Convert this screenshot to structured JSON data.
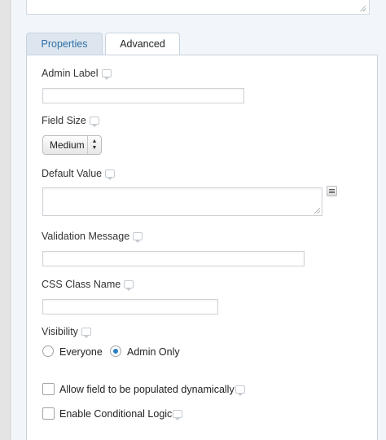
{
  "tabs": [
    {
      "label": "Properties",
      "active": false
    },
    {
      "label": "Advanced",
      "active": true
    }
  ],
  "fields": {
    "admin_label": {
      "label": "Admin Label",
      "value": ""
    },
    "field_size": {
      "label": "Field Size",
      "selected": "Medium"
    },
    "default_value": {
      "label": "Default Value",
      "value": ""
    },
    "validation_message": {
      "label": "Validation Message",
      "value": ""
    },
    "css_class_name": {
      "label": "CSS Class Name",
      "value": ""
    },
    "visibility": {
      "label": "Visibility",
      "options": [
        {
          "label": "Everyone",
          "checked": false
        },
        {
          "label": "Admin Only",
          "checked": true
        }
      ]
    },
    "populate_dynamically": {
      "label": "Allow field to be populated dynamically",
      "checked": false
    },
    "conditional_logic": {
      "label": "Enable Conditional Logic",
      "checked": false
    }
  },
  "icons": {
    "tooltip": "tooltip-icon",
    "merge_tag": "merge-tag-icon",
    "select_arrows": "updown-arrows-icon"
  },
  "colors": {
    "accent": "#2b7fc1",
    "tab_link": "#2e6ea5",
    "panel_bg": "#f2f6fb"
  }
}
